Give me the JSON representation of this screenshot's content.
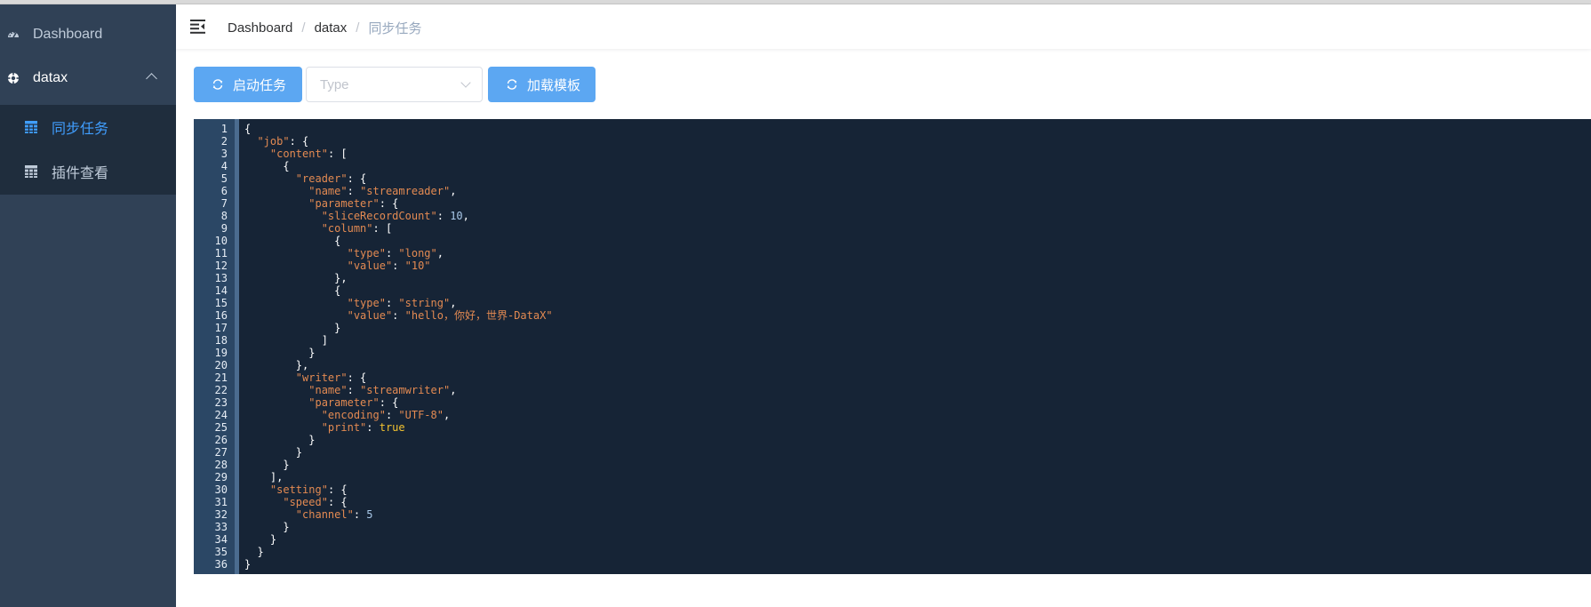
{
  "sidebar": {
    "items": [
      {
        "label": "Dashboard",
        "icon": "dashboard-icon"
      },
      {
        "label": "datax",
        "icon": "datax-icon"
      }
    ],
    "submenu": [
      {
        "label": "同步任务",
        "icon": "table-icon",
        "active": true
      },
      {
        "label": "插件查看",
        "icon": "table-icon",
        "active": false
      }
    ]
  },
  "navbar": {
    "breadcrumb": [
      "Dashboard",
      "datax",
      "同步任务"
    ]
  },
  "toolbar": {
    "start_label": "启动任务",
    "type_placeholder": "Type",
    "load_label": "加载模板"
  },
  "colors": {
    "sidebar_bg": "#304156",
    "submenu_bg": "#1f2d3d",
    "accent": "#409eff",
    "button": "#5ca7f2",
    "editor_bg": "#162436"
  },
  "editor": {
    "lines": [
      [
        {
          "t": "{",
          "c": ""
        }
      ],
      [
        {
          "t": "  ",
          "c": ""
        },
        {
          "t": "\"job\"",
          "c": "k"
        },
        {
          "t": ": {",
          "c": ""
        }
      ],
      [
        {
          "t": "    ",
          "c": ""
        },
        {
          "t": "\"content\"",
          "c": "k"
        },
        {
          "t": ": [",
          "c": ""
        }
      ],
      [
        {
          "t": "      {",
          "c": ""
        }
      ],
      [
        {
          "t": "        ",
          "c": ""
        },
        {
          "t": "\"reader\"",
          "c": "k"
        },
        {
          "t": ": {",
          "c": ""
        }
      ],
      [
        {
          "t": "          ",
          "c": ""
        },
        {
          "t": "\"name\"",
          "c": "k"
        },
        {
          "t": ": ",
          "c": ""
        },
        {
          "t": "\"streamreader\"",
          "c": "s"
        },
        {
          "t": ",",
          "c": ""
        }
      ],
      [
        {
          "t": "          ",
          "c": ""
        },
        {
          "t": "\"parameter\"",
          "c": "k"
        },
        {
          "t": ": {",
          "c": ""
        }
      ],
      [
        {
          "t": "            ",
          "c": ""
        },
        {
          "t": "\"sliceRecordCount\"",
          "c": "k"
        },
        {
          "t": ": ",
          "c": ""
        },
        {
          "t": "10",
          "c": "n"
        },
        {
          "t": ",",
          "c": ""
        }
      ],
      [
        {
          "t": "            ",
          "c": ""
        },
        {
          "t": "\"column\"",
          "c": "k"
        },
        {
          "t": ": [",
          "c": ""
        }
      ],
      [
        {
          "t": "              {",
          "c": ""
        }
      ],
      [
        {
          "t": "                ",
          "c": ""
        },
        {
          "t": "\"type\"",
          "c": "k"
        },
        {
          "t": ": ",
          "c": ""
        },
        {
          "t": "\"long\"",
          "c": "s"
        },
        {
          "t": ",",
          "c": ""
        }
      ],
      [
        {
          "t": "                ",
          "c": ""
        },
        {
          "t": "\"value\"",
          "c": "k"
        },
        {
          "t": ": ",
          "c": ""
        },
        {
          "t": "\"10\"",
          "c": "s"
        }
      ],
      [
        {
          "t": "              },",
          "c": ""
        }
      ],
      [
        {
          "t": "              {",
          "c": ""
        }
      ],
      [
        {
          "t": "                ",
          "c": ""
        },
        {
          "t": "\"type\"",
          "c": "k"
        },
        {
          "t": ": ",
          "c": ""
        },
        {
          "t": "\"string\"",
          "c": "s"
        },
        {
          "t": ",",
          "c": ""
        }
      ],
      [
        {
          "t": "                ",
          "c": ""
        },
        {
          "t": "\"value\"",
          "c": "k"
        },
        {
          "t": ": ",
          "c": ""
        },
        {
          "t": "\"hello，你好，世界-DataX\"",
          "c": "s"
        }
      ],
      [
        {
          "t": "              }",
          "c": ""
        }
      ],
      [
        {
          "t": "            ]",
          "c": ""
        }
      ],
      [
        {
          "t": "          }",
          "c": ""
        }
      ],
      [
        {
          "t": "        },",
          "c": ""
        }
      ],
      [
        {
          "t": "        ",
          "c": ""
        },
        {
          "t": "\"writer\"",
          "c": "k"
        },
        {
          "t": ": {",
          "c": ""
        }
      ],
      [
        {
          "t": "          ",
          "c": ""
        },
        {
          "t": "\"name\"",
          "c": "k"
        },
        {
          "t": ": ",
          "c": ""
        },
        {
          "t": "\"streamwriter\"",
          "c": "s"
        },
        {
          "t": ",",
          "c": ""
        }
      ],
      [
        {
          "t": "          ",
          "c": ""
        },
        {
          "t": "\"parameter\"",
          "c": "k"
        },
        {
          "t": ": {",
          "c": ""
        }
      ],
      [
        {
          "t": "            ",
          "c": ""
        },
        {
          "t": "\"encoding\"",
          "c": "k"
        },
        {
          "t": ": ",
          "c": ""
        },
        {
          "t": "\"UTF-8\"",
          "c": "s"
        },
        {
          "t": ",",
          "c": ""
        }
      ],
      [
        {
          "t": "            ",
          "c": ""
        },
        {
          "t": "\"print\"",
          "c": "k"
        },
        {
          "t": ": ",
          "c": ""
        },
        {
          "t": "true",
          "c": "b"
        }
      ],
      [
        {
          "t": "          }",
          "c": ""
        }
      ],
      [
        {
          "t": "        }",
          "c": ""
        }
      ],
      [
        {
          "t": "      }",
          "c": ""
        }
      ],
      [
        {
          "t": "    ],",
          "c": ""
        }
      ],
      [
        {
          "t": "    ",
          "c": ""
        },
        {
          "t": "\"setting\"",
          "c": "k"
        },
        {
          "t": ": {",
          "c": ""
        }
      ],
      [
        {
          "t": "      ",
          "c": ""
        },
        {
          "t": "\"speed\"",
          "c": "k"
        },
        {
          "t": ": {",
          "c": ""
        }
      ],
      [
        {
          "t": "        ",
          "c": ""
        },
        {
          "t": "\"channel\"",
          "c": "k"
        },
        {
          "t": ": ",
          "c": ""
        },
        {
          "t": "5",
          "c": "n"
        }
      ],
      [
        {
          "t": "      }",
          "c": ""
        }
      ],
      [
        {
          "t": "    }",
          "c": ""
        }
      ],
      [
        {
          "t": "  }",
          "c": ""
        }
      ],
      [
        {
          "t": "}",
          "c": ""
        }
      ]
    ]
  }
}
